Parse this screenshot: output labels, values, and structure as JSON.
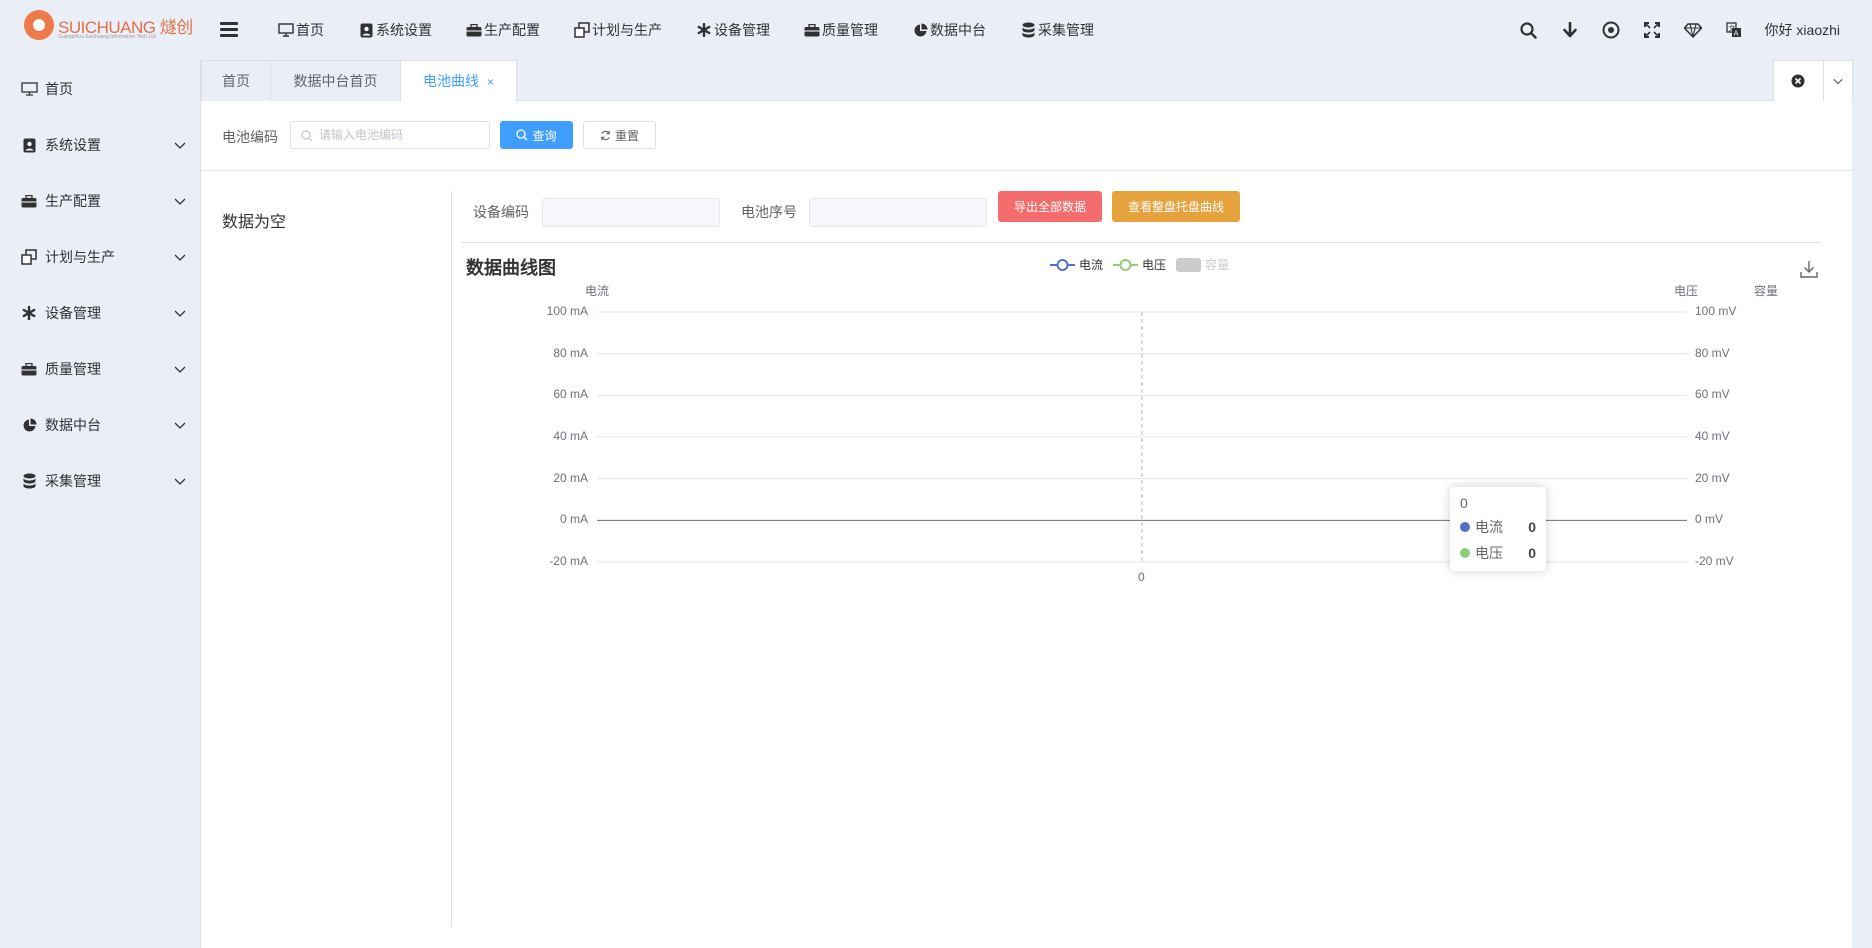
{
  "brand": {
    "name": "SUICHUANG 燧创",
    "sub": "Guangzhou Suichuang Information Tech Ltd"
  },
  "topnav": [
    {
      "label": "首页",
      "icon": "monitor-icon"
    },
    {
      "label": "系统设置",
      "icon": "user-badge-icon"
    },
    {
      "label": "生产配置",
      "icon": "briefcase-icon"
    },
    {
      "label": "计划与生产",
      "icon": "windows-icon"
    },
    {
      "label": "设备管理",
      "icon": "asterisk-icon"
    },
    {
      "label": "质量管理",
      "icon": "briefcase-icon"
    },
    {
      "label": "数据中台",
      "icon": "pie-chart-icon"
    },
    {
      "label": "采集管理",
      "icon": "database-icon"
    }
  ],
  "user": {
    "greeting": "你好 xiaozhi"
  },
  "sidebar": {
    "items": [
      {
        "label": "首页",
        "icon": "monitor-icon",
        "expandable": false
      },
      {
        "label": "系统设置",
        "icon": "user-badge-icon",
        "expandable": true
      },
      {
        "label": "生产配置",
        "icon": "briefcase-icon",
        "expandable": true
      },
      {
        "label": "计划与生产",
        "icon": "windows-icon",
        "expandable": true
      },
      {
        "label": "设备管理",
        "icon": "asterisk-icon",
        "expandable": true
      },
      {
        "label": "质量管理",
        "icon": "briefcase-icon",
        "expandable": true
      },
      {
        "label": "数据中台",
        "icon": "pie-chart-icon",
        "expandable": true
      },
      {
        "label": "采集管理",
        "icon": "database-icon",
        "expandable": true
      }
    ]
  },
  "tabs": [
    {
      "label": "首页",
      "active": false
    },
    {
      "label": "数据中台首页",
      "active": false
    },
    {
      "label": "电池曲线",
      "active": true,
      "close": "×"
    }
  ],
  "search": {
    "label": "电池编码",
    "placeholder": "请输入电池编码",
    "query_label": "查询",
    "reset_label": "重置"
  },
  "left_pane": {
    "empty_text": "数据为空"
  },
  "filters": {
    "device_label": "设备编码",
    "device_value": "",
    "seq_label": "电池序号",
    "seq_value": "",
    "export_label": "导出全部数据",
    "view_label": "查看整盘托盘曲线"
  },
  "colors": {
    "primary": "#409eff",
    "danger": "#f56c6c",
    "warning": "#e6a23c",
    "current": "#5470c6",
    "voltage": "#91cc75",
    "capacity": "#cccccc"
  },
  "chart_data": {
    "type": "line",
    "title": "数据曲线图",
    "legend": [
      "电流",
      "电压",
      "容量"
    ],
    "legend_placement": "top-center",
    "x": [
      "0"
    ],
    "y_left": {
      "name": "电流",
      "unit": "mA",
      "ticks": [
        "100 mA",
        "80 mA",
        "60 mA",
        "40 mA",
        "20 mA",
        "0 mA",
        "-20 mA"
      ],
      "range": [
        -20,
        100
      ]
    },
    "y_right": {
      "name": "电压",
      "unit": "mV",
      "ticks": [
        "100 mV",
        "80 mV",
        "60 mV",
        "40 mV",
        "20 mV",
        "0 mV",
        "-20 mV"
      ],
      "range": [
        -20,
        100
      ]
    },
    "y_right2": {
      "name": "容量"
    },
    "series": [
      {
        "name": "电流",
        "values": [
          0
        ]
      },
      {
        "name": "电压",
        "values": [
          0
        ]
      },
      {
        "name": "容量",
        "values": []
      }
    ],
    "tooltip": {
      "header": "0",
      "rows": [
        {
          "name": "电流",
          "value": "0"
        },
        {
          "name": "电压",
          "value": "0"
        }
      ]
    }
  }
}
